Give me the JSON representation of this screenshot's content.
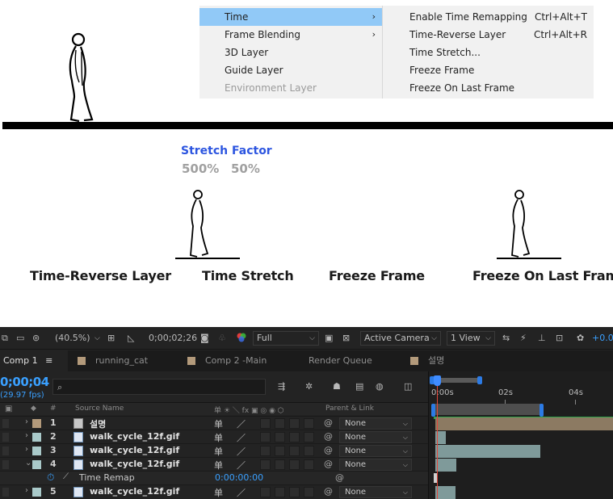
{
  "context_menu": {
    "main_items": [
      {
        "label": "Time",
        "submenu": true,
        "highlighted": true,
        "disabled": false
      },
      {
        "label": "Frame Blending",
        "submenu": true,
        "highlighted": false,
        "disabled": false
      },
      {
        "label": "3D Layer",
        "submenu": false,
        "highlighted": false,
        "disabled": false
      },
      {
        "label": "Guide Layer",
        "submenu": false,
        "highlighted": false,
        "disabled": false
      },
      {
        "label": "Environment Layer",
        "submenu": false,
        "highlighted": false,
        "disabled": true
      }
    ],
    "submenu_items": [
      {
        "label": "Enable Time Remapping",
        "shortcut": "Ctrl+Alt+T"
      },
      {
        "label": "Time-Reverse Layer",
        "shortcut": "Ctrl+Alt+R"
      },
      {
        "label": "Time Stretch...",
        "shortcut": ""
      },
      {
        "label": "Freeze Frame",
        "shortcut": ""
      },
      {
        "label": "Freeze On Last Frame",
        "shortcut": ""
      }
    ],
    "highlight_color": "#91c9f7"
  },
  "canvas": {
    "stretch_factor_title": "Stretch Factor",
    "stretch_values": [
      "500%",
      "50%"
    ],
    "demo_labels": [
      "Time-Reverse Layer",
      "Time Stretch",
      "Freeze Frame",
      "Freeze On Last Frame"
    ],
    "title_color": "#2c55e0"
  },
  "toolbar": {
    "zoom": "(40.5%)",
    "timecode": "0;00;02;26",
    "resolution": "Full",
    "camera": "Active Camera",
    "view": "1 View",
    "exposure": "+0.0"
  },
  "tabs": {
    "items": [
      "Comp 1",
      "running_cat",
      "Comp 2 -Main",
      "Render Queue",
      "설명"
    ],
    "active": "Comp 1",
    "menu_glyph": "≡"
  },
  "composition": {
    "current_time": "0;00;04",
    "fps": "(29.97 fps)",
    "search_placeholder": "⌕"
  },
  "columns": {
    "hash": "#",
    "source_name": "Source Name",
    "switches": "单 ☀ ＼ fx ▣ ◎ ◉ ⬡",
    "parent_link": "Parent & Link"
  },
  "layers": [
    {
      "number": "1",
      "name": "설명",
      "type": "comp",
      "label_color": "#b39a7b",
      "parent": "None",
      "expanded": false
    },
    {
      "number": "2",
      "name": "walk_cycle_12f.gif",
      "type": "footage",
      "label_color": "#a9c9c9",
      "parent": "None",
      "expanded": false
    },
    {
      "number": "3",
      "name": "walk_cycle_12f.gif",
      "type": "footage",
      "label_color": "#a9c9c9",
      "parent": "None",
      "expanded": false
    },
    {
      "number": "4",
      "name": "walk_cycle_12f.gif",
      "type": "footage",
      "label_color": "#a9c9c9",
      "parent": "None",
      "expanded": true
    },
    {
      "number": "5",
      "name": "walk_cycle_12f.gif",
      "type": "footage",
      "label_color": "#a9c9c9",
      "parent": "None",
      "expanded": false
    }
  ],
  "time_remap": {
    "label": "Time Remap",
    "value": "0:00:00:00"
  },
  "timeline": {
    "ticks": [
      "0:00s",
      "02s",
      "04s"
    ],
    "playhead_color": "#e2463a",
    "bar_color": "#8a8a8a"
  }
}
